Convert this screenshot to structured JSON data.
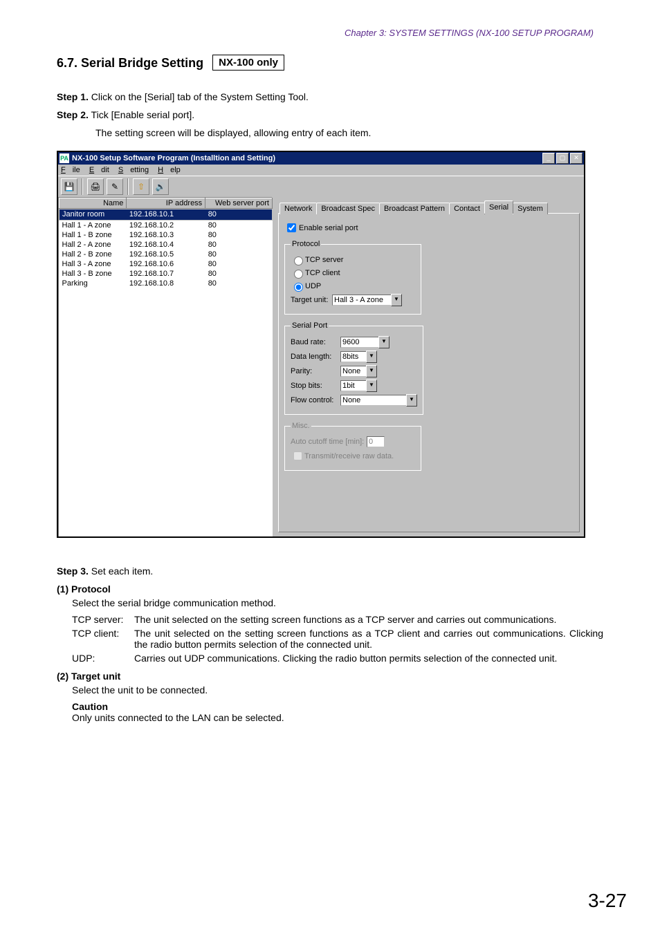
{
  "chapter": "Chapter 3:  SYSTEM SETTINGS (NX-100 SETUP PROGRAM)",
  "section": {
    "num": "6.7.",
    "title": "Serial Bridge Setting",
    "badge": "NX-100 only"
  },
  "steps": {
    "s1_label": "Step 1.",
    "s1_text": "Click on the [Serial] tab of the System Setting Tool.",
    "s2_label": "Step 2.",
    "s2_text": "Tick [Enable serial port].",
    "s2_sub": "The setting screen will be displayed, allowing entry of each item.",
    "s3_label": "Step 3.",
    "s3_text": "Set each item."
  },
  "win": {
    "title": "NX-100 Setup Software Program (Installtion and Setting)",
    "menu": {
      "file": "File",
      "edit": "Edit",
      "setting": "Setting",
      "help": "Help"
    },
    "icons": {
      "save": "💾",
      "scan": "🖨",
      "edit": "✎",
      "up": "⇧",
      "audio": "🔊"
    },
    "cols": {
      "name": "Name",
      "ip": "IP address",
      "port": "Web server port"
    },
    "rows": [
      {
        "name": "Janitor room",
        "ip": "192.168.10.1",
        "port": "80",
        "selected": true
      },
      {
        "name": "Hall 1 - A zone",
        "ip": "192.168.10.2",
        "port": "80"
      },
      {
        "name": "Hall 1 - B zone",
        "ip": "192.168.10.3",
        "port": "80"
      },
      {
        "name": "Hall 2 - A zone",
        "ip": "192.168.10.4",
        "port": "80"
      },
      {
        "name": "Hall 2 - B zone",
        "ip": "192.168.10.5",
        "port": "80"
      },
      {
        "name": "Hall 3 - A zone",
        "ip": "192.168.10.6",
        "port": "80"
      },
      {
        "name": "Hall 3 - B zone",
        "ip": "192.168.10.7",
        "port": "80"
      },
      {
        "name": "Parking",
        "ip": "192.168.10.8",
        "port": "80"
      }
    ],
    "tabs": {
      "network": "Network",
      "bspec": "Broadcast Spec",
      "bpattern": "Broadcast Pattern",
      "contact": "Contact",
      "serial": "Serial",
      "system": "System"
    },
    "serial": {
      "enable": "Enable serial port",
      "protocol_legend": "Protocol",
      "tcp_server": "TCP server",
      "tcp_client": "TCP client",
      "udp": "UDP",
      "target_label": "Target unit:",
      "target_value": "Hall 3 - A zone",
      "sp_legend": "Serial Port",
      "baud_label": "Baud rate:",
      "baud_value": "9600",
      "dlen_label": "Data length:",
      "dlen_value": "8bits",
      "parity_label": "Parity:",
      "parity_value": "None",
      "stop_label": "Stop bits:",
      "stop_value": "1bit",
      "flow_label": "Flow control:",
      "flow_value": "None",
      "misc_legend": "Misc.",
      "cutoff_label": "Auto cutoff time [min]:",
      "cutoff_value": "0",
      "raw": "Transmit/receive raw data."
    }
  },
  "desc": {
    "h1": "(1) Protocol",
    "h1_text": "Select the serial bridge communication method.",
    "tcp_server_term": "TCP server:",
    "tcp_server_desc": "The unit selected on the setting screen functions as a TCP server and carries out communications.",
    "tcp_client_term": "TCP client:",
    "tcp_client_desc": "The unit selected on the setting screen functions as a TCP client and carries out communications. Clicking the radio button permits selection of the connected unit.",
    "udp_term": "UDP:",
    "udp_desc": "Carries out UDP communications. Clicking the radio button permits selection of the connected unit.",
    "h2": "(2) Target unit",
    "h2_text": "Select the unit to be connected.",
    "caution": "Caution",
    "caution_text": "Only units connected to the LAN can be selected."
  },
  "page_num": "3-27"
}
